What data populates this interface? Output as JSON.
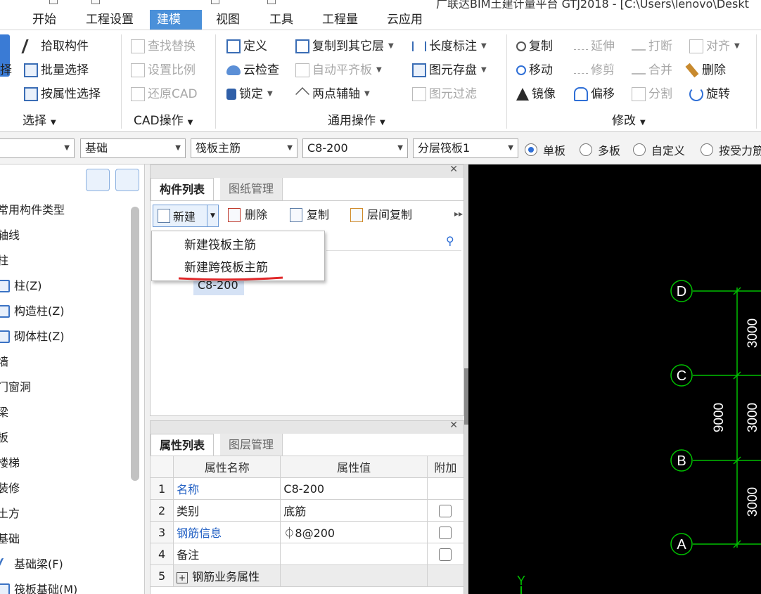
{
  "title": {
    "text": "广联达BIM土建计量平台 GTJ2018 - [C:\\Users\\lenovo\\Deskt"
  },
  "menu": {
    "tabs": [
      {
        "label": "开始"
      },
      {
        "label": "工程设置"
      },
      {
        "label": "建模"
      },
      {
        "label": "视图"
      },
      {
        "label": "工具"
      },
      {
        "label": "工程量"
      },
      {
        "label": "云应用"
      }
    ],
    "active": "建模"
  },
  "ribbon": {
    "select_group": {
      "b1": "拾取构件",
      "b2": "批量选择",
      "b3": "按属性选择",
      "partial": "择",
      "label": "选择"
    },
    "cad_group": {
      "b1": "查找替换",
      "b2": "设置比例",
      "b3": "还原CAD",
      "label": "CAD操作"
    },
    "common_group": {
      "b1": "定义",
      "b2": "云检查",
      "b3": "锁定",
      "b4": "复制到其它层",
      "b5": "自动平齐板",
      "b6": "两点辅轴",
      "b7": "长度标注",
      "b8": "图元存盘",
      "b9": "图元过滤",
      "label": "通用操作"
    },
    "modify_group": {
      "b1": "复制",
      "b2": "延伸",
      "b3": "打断",
      "b4": "对齐",
      "b5": "移动",
      "b6": "修剪",
      "b7": "合并",
      "b8": "删除",
      "b9": "镜像",
      "b10": "偏移",
      "b11": "分割",
      "b12": "旋转",
      "label": "修改"
    }
  },
  "toolbar": {
    "combo_floor": "",
    "combo_category": "基础",
    "combo_type": "筏板主筋",
    "combo_item": "C8-200",
    "combo_layer": "分层筏板1",
    "radio_single": "单板",
    "radio_multi": "多板",
    "radio_custom": "自定义",
    "radio_force": "按受力筋",
    "selected_radio": "单板"
  },
  "leftnav": {
    "items": [
      {
        "label": "常用构件类型"
      },
      {
        "label": "轴线"
      },
      {
        "label": "柱"
      },
      {
        "label": "柱(Z)"
      },
      {
        "label": "构造柱(Z)"
      },
      {
        "label": "砌体柱(Z)"
      },
      {
        "label": "墙"
      },
      {
        "label": "门窗洞"
      },
      {
        "label": "梁"
      },
      {
        "label": "板"
      },
      {
        "label": "楼梯"
      },
      {
        "label": "装修"
      },
      {
        "label": "土方"
      },
      {
        "label": "基础"
      },
      {
        "label": "基础梁(F)"
      },
      {
        "label": "筏板基础(M)"
      }
    ]
  },
  "component_panel": {
    "tab_active": "构件列表",
    "tab_other": "图纸管理",
    "new": "新建",
    "delete": "删除",
    "copy": "复制",
    "floor_copy": "层间复制",
    "dropdown": [
      "新建筏板主筋",
      "新建跨筏板主筋"
    ],
    "selected_item": "C8-200"
  },
  "property_panel": {
    "tab_active": "属性列表",
    "tab_other": "图层管理",
    "headers": {
      "name": "属性名称",
      "value": "属性值",
      "extra": "附加"
    },
    "rows": [
      {
        "num": "1",
        "name": "名称",
        "value": "C8-200"
      },
      {
        "num": "2",
        "name": "类别",
        "value": "底筋"
      },
      {
        "num": "3",
        "name": "钢筋信息",
        "value": "⏀8@200"
      },
      {
        "num": "4",
        "name": "备注",
        "value": ""
      },
      {
        "num": "5",
        "name": "钢筋业务属性",
        "value": ""
      }
    ]
  },
  "canvas": {
    "axes": [
      "D",
      "C",
      "B",
      "A"
    ],
    "dims": [
      "3000",
      "3000",
      "3000",
      "9000"
    ],
    "ucs": "Y",
    "colors": {
      "background": "#000000",
      "axis": "#00c000",
      "text": "#ffffff"
    }
  }
}
